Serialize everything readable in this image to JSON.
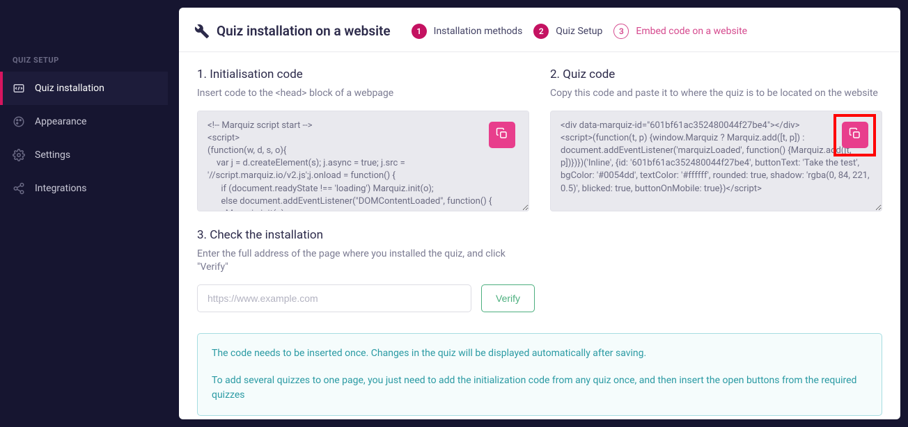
{
  "sidebar": {
    "heading": "QUIZ SETUP",
    "items": [
      {
        "label": "Quiz installation"
      },
      {
        "label": "Appearance"
      },
      {
        "label": "Settings"
      },
      {
        "label": "Integrations"
      }
    ]
  },
  "header": {
    "title": "Quiz installation on a website",
    "breadcrumbs": [
      {
        "num": "1",
        "label": "Installation methods"
      },
      {
        "num": "2",
        "label": "Quiz Setup"
      },
      {
        "num": "3",
        "label": "Embed code on a website"
      }
    ]
  },
  "sections": {
    "init": {
      "title": "1. Initialisation code",
      "desc": "Insert code to the <head> block of a webpage",
      "code": "<!-- Marquiz script start -->\n<script>\n(function(w, d, s, o){\n    var j = d.createElement(s); j.async = true; j.src = '//script.marquiz.io/v2.js';j.onload = function() {\n      if (document.readyState !== 'loading') Marquiz.init(o);\n      else document.addEventListener(\"DOMContentLoaded\", function() {\n        Marquiz.init(o);"
    },
    "quiz": {
      "title": "2. Quiz code",
      "desc": "Copy this code and paste it to where the quiz is to be located on the website",
      "code": "<div data-marquiz-id=\"601bf61ac352480044f27be4\"></div>\n<script>(function(t, p) {window.Marquiz ? Marquiz.add([t, p]) : document.addEventListener('marquizLoaded', function() {Marquiz.add([t, p])})})('Inline', {id: '601bf61ac352480044f27be4', buttonText: 'Take the test', bgColor: '#0054dd', textColor: '#ffffff', rounded: true, shadow: 'rgba(0, 84, 221, 0.5)', blicked: true, buttonOnMobile: true})</script>"
    },
    "check": {
      "title": "3. Check the installation",
      "desc": "Enter the full address of the page where you installed the quiz, and click \"Verify\"",
      "placeholder": "https://www.example.com",
      "verify": "Verify"
    }
  },
  "info": {
    "line1": "The code needs to be inserted once. Changes in the quiz will be displayed automatically after saving.",
    "line2": "To add several quizzes to one page, you just need to add the initialization code from any quiz once, and then insert the open buttons from the required quizzes"
  }
}
